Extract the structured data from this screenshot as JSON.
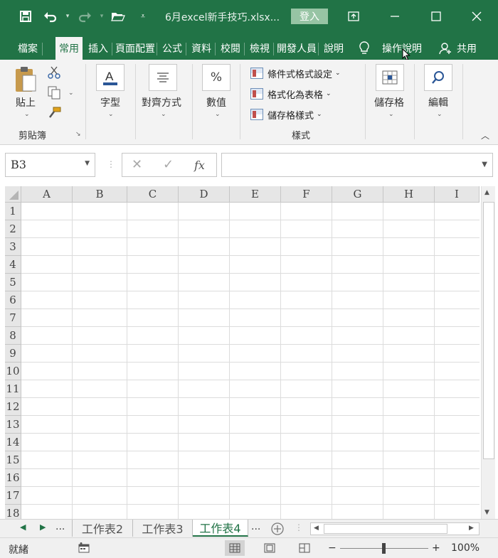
{
  "window": {
    "filename": "6月excel新手技巧.xlsx...",
    "login_label": "登入"
  },
  "tabs": [
    "檔案",
    "常用",
    "插入",
    "頁面配置",
    "公式",
    "資料",
    "校閱",
    "檢視",
    "開發人員",
    "說明"
  ],
  "tabs_right": {
    "tell_me": "操作說明",
    "share": "共用"
  },
  "ribbon": {
    "clipboard": {
      "paste": "貼上",
      "group": "剪貼簿"
    },
    "font": {
      "label": "字型"
    },
    "alignment": {
      "label": "對齊方式"
    },
    "number": {
      "label": "數值",
      "icon_text": "%"
    },
    "styles": {
      "items": [
        "條件式格式設定",
        "格式化為表格",
        "儲存格樣式"
      ],
      "group": "樣式"
    },
    "cells": {
      "label": "儲存格"
    },
    "editing": {
      "label": "編輯"
    }
  },
  "formula_bar": {
    "name_box": "B3",
    "fx": "fx",
    "formula": ""
  },
  "grid": {
    "columns": [
      "A",
      "B",
      "C",
      "D",
      "E",
      "F",
      "G",
      "H",
      "I"
    ],
    "rows": [
      "1",
      "2",
      "3",
      "4",
      "5",
      "6",
      "7",
      "8",
      "9",
      "10",
      "11",
      "12",
      "13",
      "14",
      "15",
      "16",
      "17",
      "18"
    ]
  },
  "sheets": {
    "tabs": [
      "工作表2",
      "工作表3",
      "工作表4"
    ],
    "active": "工作表4",
    "ellipsis": "..."
  },
  "status": {
    "ready": "就緒",
    "zoom": "100%"
  },
  "colors": {
    "accent": "#217346",
    "ribbon_bg": "#f3f3f3",
    "login_bg": "#97c4a4"
  }
}
